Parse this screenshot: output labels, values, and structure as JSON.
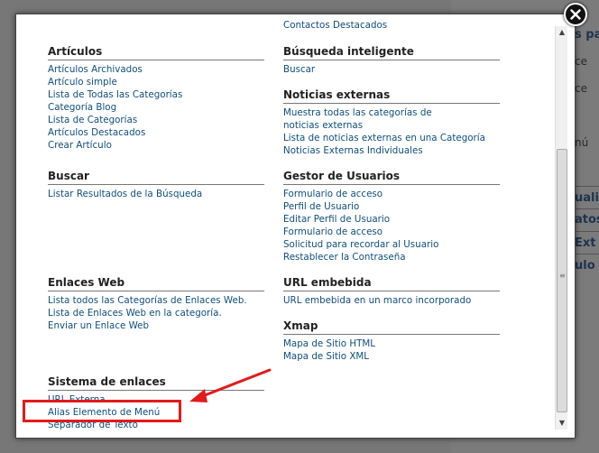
{
  "background": {
    "fragments": [
      "s pa",
      "ce",
      "ce",
      "nú",
      "uali",
      "atos",
      "Ext",
      "ulo p"
    ]
  },
  "modal": {
    "top_cut_item": "Contactos Destacados",
    "sections": {
      "articulos": {
        "title": "Artículos",
        "items": [
          "Artículos Archivados",
          "Artículo simple",
          "Lista de Todas las Categorías",
          "Categoría Blog",
          "Lista de Categorías",
          "Artículos Destacados",
          "Crear Artículo"
        ]
      },
      "buscar": {
        "title": "Buscar",
        "items": [
          "Listar Resultados de la Búsqueda"
        ]
      },
      "enlaces_web": {
        "title": "Enlaces Web",
        "items": [
          "Lista todos las Categorías de Enlaces Web.",
          "Lista de Enlaces Web en la categoría.",
          "Enviar un Enlace Web"
        ]
      },
      "sistema_enlaces": {
        "title": "Sistema de enlaces",
        "items": [
          "URL Externa",
          "Alias Elemento de Menú",
          "Separador de Texto"
        ]
      },
      "busqueda_inteligente": {
        "title": "Búsqueda inteligente",
        "items": [
          "Buscar"
        ]
      },
      "noticias_externas": {
        "title": "Noticias externas",
        "items": [
          "Muestra todas las categorías de noticias externas",
          "Lista de noticias externas en una Categoría",
          "Noticias Externas Individuales"
        ]
      },
      "gestor_usuarios": {
        "title": "Gestor de Usuarios",
        "items": [
          "Formulario de acceso",
          "Perfil de Usuario",
          "Editar Perfil de Usuario",
          "Formulario de acceso",
          "Solicitud para recordar al Usuario",
          "Restablecer la Contraseña"
        ]
      },
      "url_embebida": {
        "title": "URL embebida",
        "items": [
          "URL embebida en un marco incorporado"
        ]
      },
      "xmap": {
        "title": "Xmap",
        "items": [
          "Mapa de Sitio HTML",
          "Mapa de Sitio XML"
        ]
      }
    }
  },
  "colors": {
    "link": "#0f4f7c",
    "annotation_red": "#e21b1b"
  },
  "icons": [
    "close-icon",
    "scroll-up-arrow-icon",
    "scroll-down-arrow-icon",
    "scroll-grip-icon",
    "annotation-arrow-icon"
  ]
}
